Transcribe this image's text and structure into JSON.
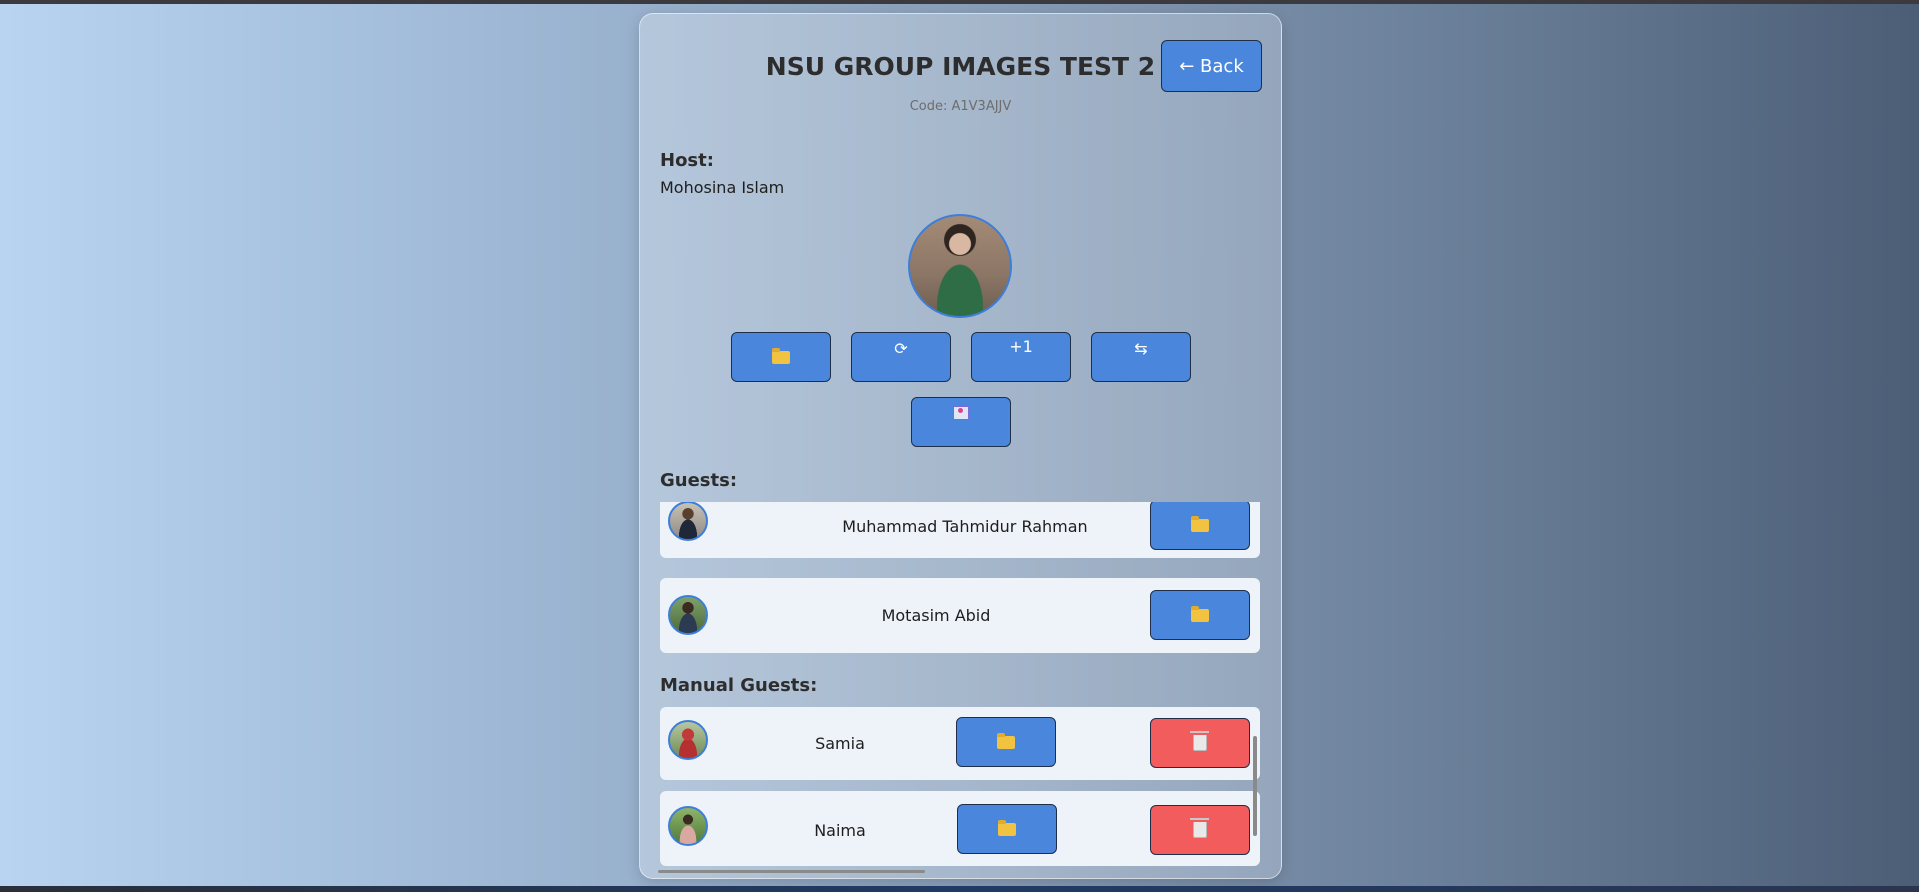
{
  "event": {
    "title": "NSU GROUP IMAGES TEST 2",
    "code": "Code: A1V3AJJV",
    "back_label": "← Back"
  },
  "host": {
    "section_label": "Host:",
    "name": "Mohosina Islam",
    "actions": [
      {
        "icon": "folder-icon",
        "glyph": ""
      },
      {
        "icon": "refresh-icon",
        "glyph": "⟳"
      },
      {
        "icon": "plus-one-icon",
        "glyph": "+1"
      },
      {
        "icon": "swap-icon",
        "glyph": "⇆"
      },
      {
        "icon": "photo-frame-icon",
        "glyph": ""
      }
    ]
  },
  "guests": {
    "section_label": "Guests:",
    "items": [
      {
        "name": "Muhammad Tahmidur Rahman"
      },
      {
        "name": "Motasim Abid"
      }
    ]
  },
  "manual_guests": {
    "section_label": "Manual Guests:",
    "items": [
      {
        "name": "Samia"
      },
      {
        "name": "Naima"
      }
    ]
  },
  "colors": {
    "button_blue": "#4a86dc",
    "delete_red": "#f25c5c",
    "row_bg": "#eef2f9",
    "avatar_border": "#3d7ed8"
  }
}
